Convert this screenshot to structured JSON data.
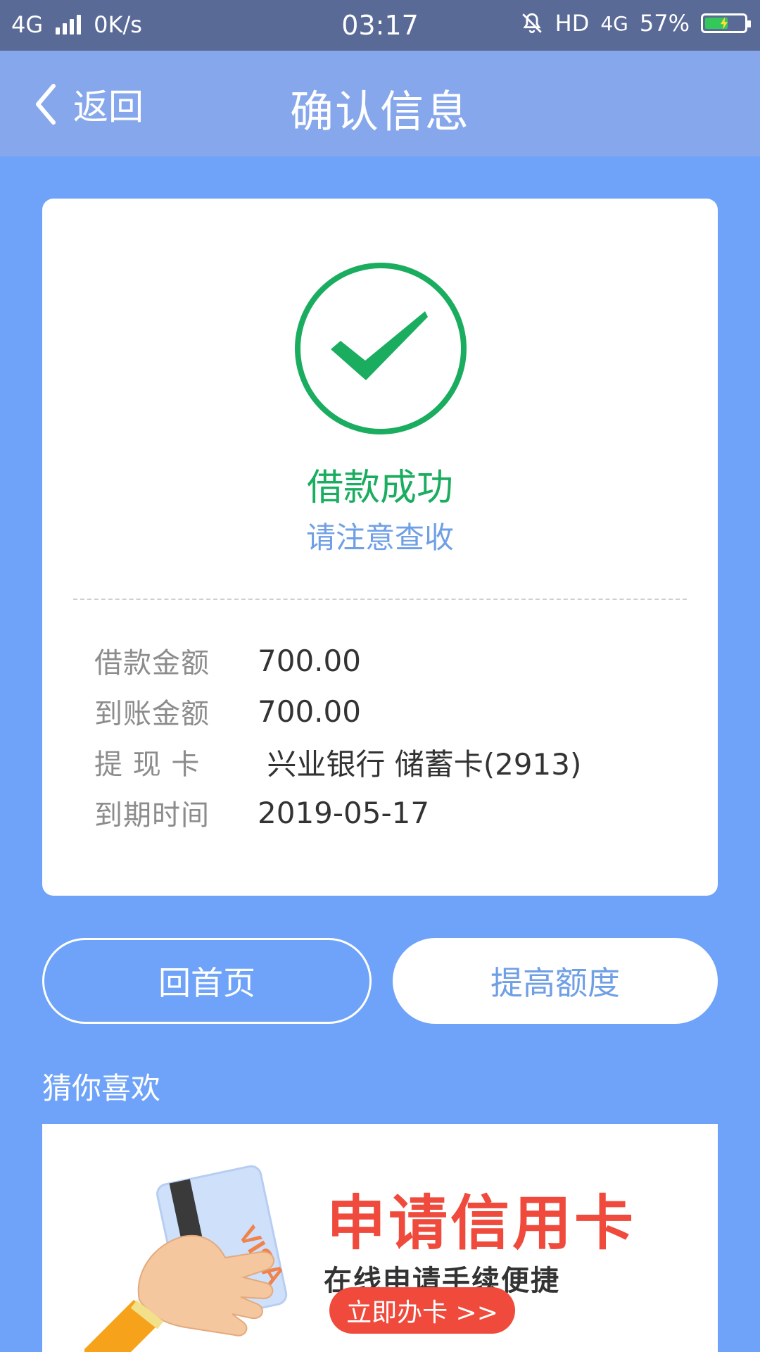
{
  "status_bar": {
    "network": "4G",
    "speed": "0K/s",
    "time": "03:17",
    "hd": "HD",
    "network_right": "4G",
    "battery": "57%"
  },
  "header": {
    "back_label": "返回",
    "title": "确认信息"
  },
  "result": {
    "title": "借款成功",
    "subtitle": "请注意查收"
  },
  "details": {
    "items": [
      {
        "label": "借款金额",
        "value": "700.00"
      },
      {
        "label": "到账金额",
        "value": "700.00"
      },
      {
        "label": "提 现 卡",
        "value": " 兴业银行 储蓄卡(2913)"
      },
      {
        "label": "到期时间",
        "value": "2019-05-17"
      }
    ]
  },
  "actions": {
    "home": "回首页",
    "raise_limit": "提高额度"
  },
  "recommend": {
    "title": "猜你喜欢",
    "banner": {
      "headline": "申请信用卡",
      "subline": "在线申请手续便捷",
      "cta": "立即办卡 >>",
      "card_text": "VISA"
    }
  },
  "colors": {
    "background": "#6ea3f9",
    "status_bar": "#5a6a96",
    "header": "#87a7ed",
    "success_green": "#1aad60",
    "accent_blue": "#6f9fe5",
    "banner_red": "#ef4a3c"
  }
}
